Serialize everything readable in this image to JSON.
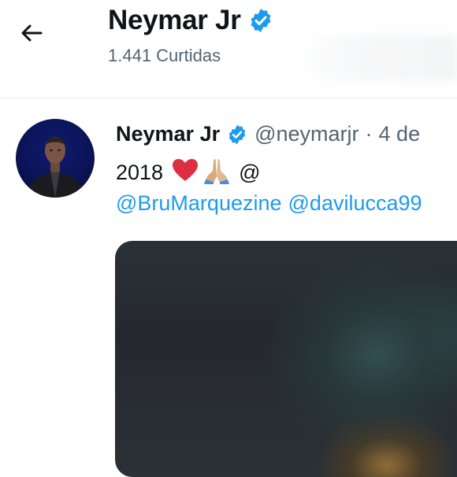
{
  "header": {
    "back_label": "",
    "title": "Neymar Jr",
    "subtitle": "1.441 Curtidas"
  },
  "tweet": {
    "author_name": "Neymar Jr",
    "handle": "@neymarjr",
    "separator": "·",
    "date": "4 de",
    "text_year": "2018",
    "text_at": "@",
    "mentions": [
      "@BruMarquezine",
      "@davilucca99"
    ],
    "media_description": ""
  },
  "colors": {
    "verified": "#1d9bf0",
    "link": "#1d9bf0",
    "secondary_text": "#536471",
    "primary_text": "#0f1419"
  },
  "icons": {
    "back": "arrow-left-icon",
    "verified": "verified-badge-icon",
    "heart": "red-heart-emoji",
    "pray": "folded-hands-emoji"
  }
}
